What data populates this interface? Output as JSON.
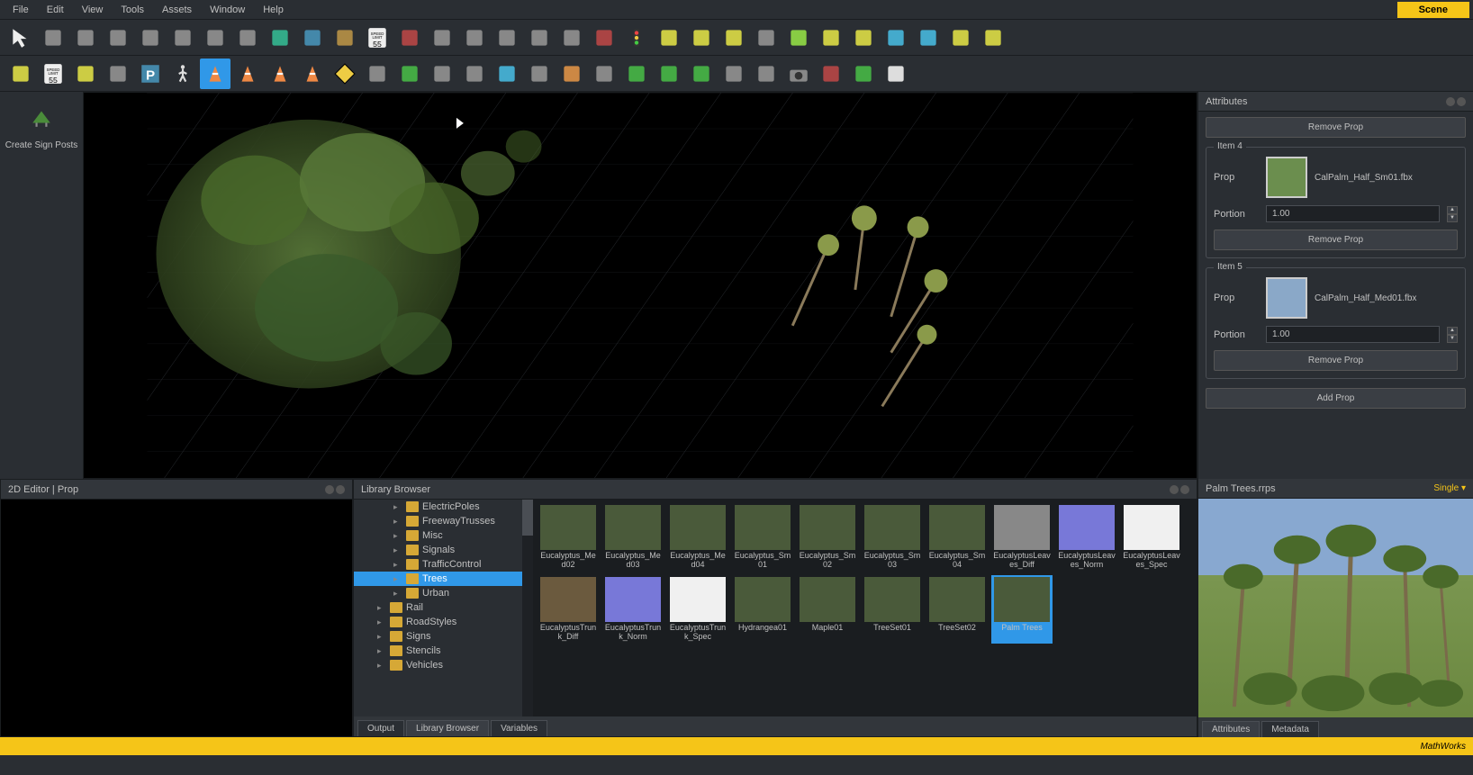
{
  "menu": [
    "File",
    "Edit",
    "View",
    "Tools",
    "Assets",
    "Window",
    "Help"
  ],
  "scene_tab": "Scene",
  "left_tool": {
    "label": "Create Sign Posts"
  },
  "attributes": {
    "title": "Attributes",
    "remove_top": "Remove Prop",
    "item4": {
      "title": "Item 4",
      "prop_label": "Prop",
      "file": "CalPalm_Half_Sm01.fbx",
      "portion_label": "Portion",
      "portion": "1.00",
      "remove": "Remove Prop"
    },
    "item5": {
      "title": "Item 5",
      "prop_label": "Prop",
      "file": "CalPalm_Half_Med01.fbx",
      "portion_label": "Portion",
      "portion": "1.00",
      "remove": "Remove Prop"
    },
    "add": "Add Prop"
  },
  "editor_2d": {
    "title": "2D Editor | Prop"
  },
  "browser": {
    "title": "Library Browser",
    "tree": [
      {
        "label": "ElectricPoles",
        "depth": 2
      },
      {
        "label": "FreewayTrusses",
        "depth": 2
      },
      {
        "label": "Misc",
        "depth": 2
      },
      {
        "label": "Signals",
        "depth": 2
      },
      {
        "label": "TrafficControl",
        "depth": 2
      },
      {
        "label": "Trees",
        "depth": 2,
        "selected": true
      },
      {
        "label": "Urban",
        "depth": 2
      },
      {
        "label": "Rail",
        "depth": 1
      },
      {
        "label": "RoadStyles",
        "depth": 1
      },
      {
        "label": "Signs",
        "depth": 1
      },
      {
        "label": "Stencils",
        "depth": 1
      },
      {
        "label": "Vehicles",
        "depth": 1
      }
    ],
    "assets": [
      {
        "label": "Eucalyptus_Med02",
        "cls": "col"
      },
      {
        "label": "Eucalyptus_Med03",
        "cls": "col"
      },
      {
        "label": "Eucalyptus_Med04",
        "cls": "col"
      },
      {
        "label": "Eucalyptus_Sm01",
        "cls": "col"
      },
      {
        "label": "Eucalyptus_Sm02",
        "cls": "col"
      },
      {
        "label": "Eucalyptus_Sm03",
        "cls": "col"
      },
      {
        "label": "Eucalyptus_Sm04",
        "cls": "col"
      },
      {
        "label": "EucalyptusLeaves_Diff",
        "cls": "texture"
      },
      {
        "label": "EucalyptusLeaves_Norm",
        "cls": "normal"
      },
      {
        "label": "EucalyptusLeaves_Spec",
        "cls": "spec"
      },
      {
        "label": "EucalyptusTrunk_Diff",
        "cls": "bark"
      },
      {
        "label": "EucalyptusTrunk_Norm",
        "cls": "normal"
      },
      {
        "label": "EucalyptusTrunk_Spec",
        "cls": "spec"
      },
      {
        "label": "Hydrangea01",
        "cls": "col"
      },
      {
        "label": "Maple01",
        "cls": "col"
      },
      {
        "label": "TreeSet01",
        "cls": "col"
      },
      {
        "label": "TreeSet02",
        "cls": "col"
      },
      {
        "label": "Palm Trees",
        "cls": "col",
        "selected": true
      }
    ]
  },
  "bottom_tabs": [
    "Output",
    "Library Browser",
    "Variables"
  ],
  "preview": {
    "title": "Palm Trees.rrps",
    "mode": "Single ▾",
    "tabs": [
      "Attributes",
      "Metadata"
    ]
  },
  "status": {
    "brand": "MathWorks"
  },
  "toolbar1": [
    "arrow",
    "curve",
    "circle",
    "sroad",
    "merge",
    "rotate",
    "road",
    "rect",
    "srf1",
    "srf2",
    "srf3",
    "speed",
    "corner",
    "jct1",
    "jct2",
    "jct3",
    "jct4",
    "jct5",
    "jct6",
    "light",
    "align1",
    "align2",
    "align3",
    "align4",
    "lane1",
    "lane2",
    "lane3",
    "lane4",
    "lane5",
    "lane6",
    "lane7"
  ],
  "toolbar2": [
    "ln1",
    "speed2",
    "sloop",
    "poly",
    "park",
    "ped",
    "cone-active",
    "cone2",
    "cone3",
    "cone4",
    "hazard",
    "grid",
    "terrain",
    "tools",
    "anchor",
    "tex",
    "scan",
    "graph",
    "fork",
    "layer1",
    "layer2",
    "layer3",
    "layer4",
    "ruler",
    "cam",
    "rec",
    "arr",
    "dup"
  ]
}
